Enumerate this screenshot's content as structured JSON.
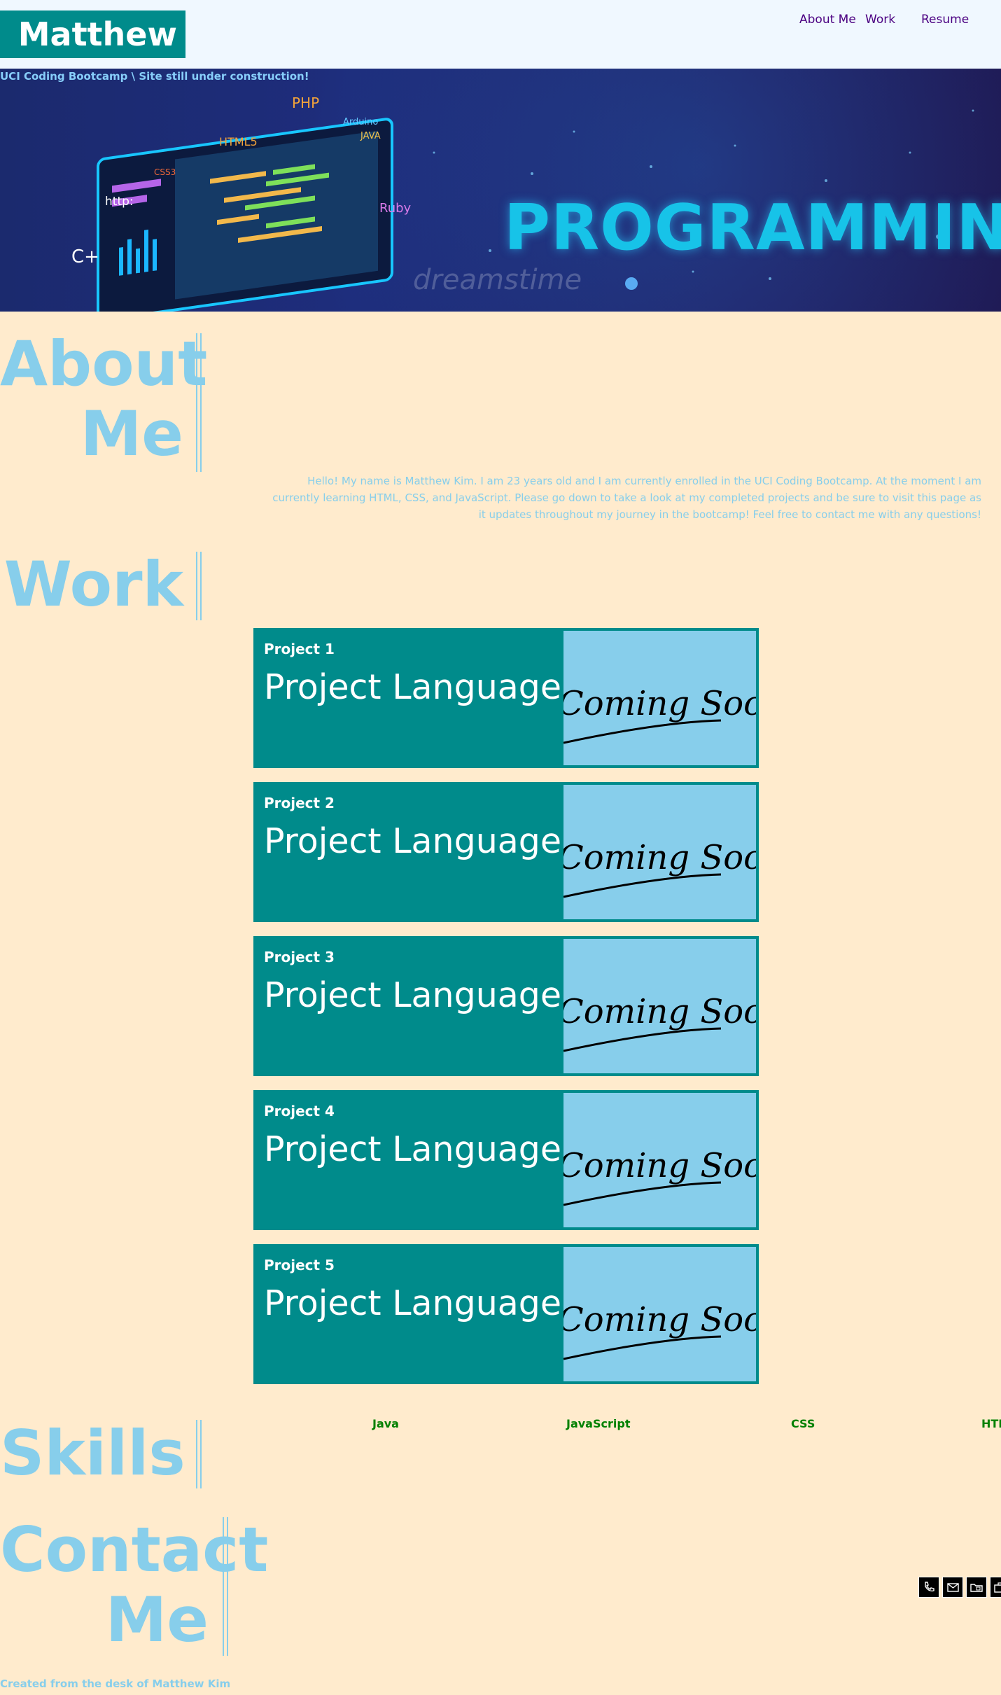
{
  "header": {
    "brand": "Matthew",
    "nav": [
      "About Me",
      "Work",
      "Resume"
    ]
  },
  "hero": {
    "caption": "UCI Coding Bootcamp \\ Site still under construction!",
    "word": "PROGRAMMING",
    "watermark": "dreamstime",
    "tags": [
      "PHP",
      "HTML5",
      "CSS3",
      "Arduino",
      "JAVA",
      "Ruby",
      "http:",
      "C+"
    ]
  },
  "about": {
    "title_line1": "About",
    "title_line2": "Me",
    "text": "Hello! My name is Matthew Kim. I am 23 years old and I am currently enrolled in the UCI Coding Bootcamp. At the moment I am currently learning HTML, CSS, and JavaScript. Please go down to take a look at my completed projects and be sure to visit this page as it updates throughout my journey in the bootcamp! Feel free to contact me with any questions!"
  },
  "work": {
    "title": "Work",
    "projects": [
      {
        "label": "Project 1",
        "language": "Project Language",
        "image_text": "Coming Soon!"
      },
      {
        "label": "Project 2",
        "language": "Project Language",
        "image_text": "Coming Soon!"
      },
      {
        "label": "Project 3",
        "language": "Project Language",
        "image_text": "Coming Soon!"
      },
      {
        "label": "Project 4",
        "language": "Project Language",
        "image_text": "Coming Soon!"
      },
      {
        "label": "Project 5",
        "language": "Project Language",
        "image_text": "Coming Soon!"
      }
    ]
  },
  "skills": {
    "title": "Skills",
    "items": [
      "Java",
      "JavaScript",
      "CSS",
      "HTML"
    ]
  },
  "contact": {
    "title_line1": "Contact",
    "title_line2": "Me",
    "icons": [
      "phone-icon",
      "email-icon",
      "folder-icon",
      "briefcase-icon"
    ]
  },
  "footer": {
    "text": "Created from the desk of Matthew Kim"
  },
  "colors": {
    "page_bg": "#ffebcd",
    "header_bg": "#f0f8ff",
    "brand_bg": "#008b8b",
    "accent": "#87ceeb",
    "nav_link": "#4b0082",
    "skill_text": "#008000"
  }
}
